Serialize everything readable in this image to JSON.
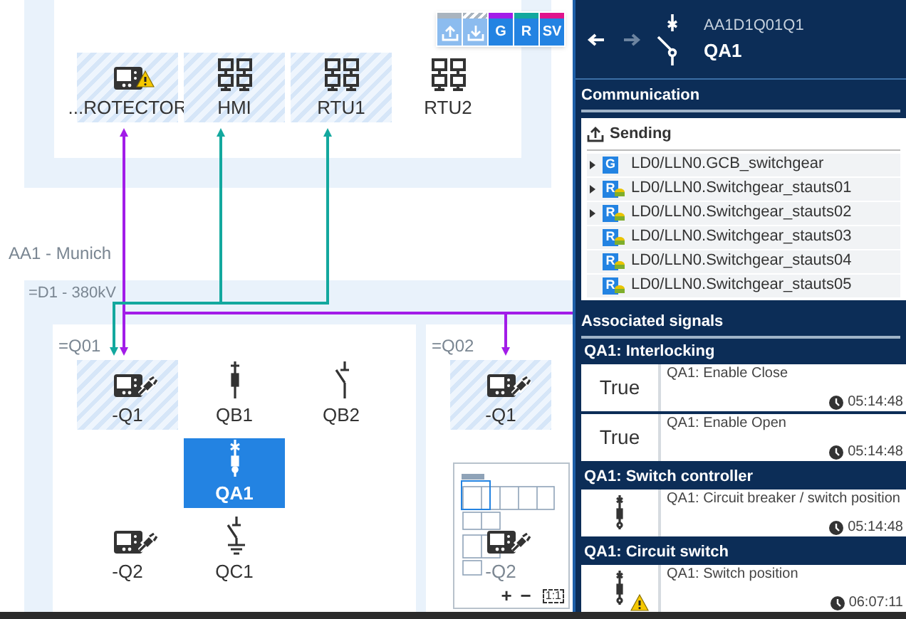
{
  "canvas": {
    "toolbar": [
      {
        "kind": "send",
        "color": "#a9b4bf"
      },
      {
        "kind": "receive",
        "color": "#a9b4bf"
      },
      {
        "kind": "letter",
        "label": "G",
        "color": "#a21ce8"
      },
      {
        "kind": "letter",
        "label": "R",
        "color": "#13a89e"
      },
      {
        "kind": "letter",
        "label": "SV",
        "color": "#e0138c"
      }
    ],
    "station": {
      "devices": [
        {
          "label": "...ROTECTOR",
          "kind": "ied",
          "hatched": true,
          "warning": true,
          "selected": false
        },
        {
          "label": "HMI",
          "kind": "network",
          "hatched": true,
          "warning": false,
          "selected": false
        },
        {
          "label": "RTU1",
          "kind": "network",
          "hatched": true,
          "warning": false,
          "selected": false
        },
        {
          "label": "RTU2",
          "kind": "network",
          "hatched": false,
          "warning": false,
          "selected": false
        }
      ]
    },
    "area_label": "AA1 - Munich",
    "voltage_level": {
      "label": "=D1 - 380kV",
      "bays": [
        {
          "label": "=Q01",
          "devices": [
            {
              "label": "-Q1",
              "kind": "ied-plug",
              "hatched": true,
              "warning": false,
              "selected": false
            },
            {
              "label": "QB1",
              "kind": "disconnector",
              "hatched": false,
              "warning": false,
              "selected": false
            },
            {
              "label": "QB2",
              "kind": "disconnector-open",
              "hatched": false,
              "warning": false,
              "selected": false
            },
            {
              "label": "QA1",
              "kind": "breaker",
              "hatched": false,
              "warning": false,
              "selected": true
            },
            {
              "label": "-Q2",
              "kind": "ied-plug",
              "hatched": false,
              "warning": false,
              "selected": false
            },
            {
              "label": "QC1",
              "kind": "earth-switch",
              "hatched": false,
              "warning": false,
              "selected": false
            }
          ]
        },
        {
          "label": "=Q02",
          "devices": [
            {
              "label": "-Q1",
              "kind": "ied-plug",
              "hatched": true,
              "warning": false,
              "selected": false
            },
            {
              "label": "-Q2",
              "kind": "ied-plug",
              "hatched": false,
              "warning": false,
              "selected": false
            }
          ]
        }
      ]
    },
    "connections": [
      {
        "color": "#a21ce8"
      },
      {
        "color": "#13a89e"
      }
    ],
    "minimap": {
      "zoom_controls": [
        "+",
        "−",
        "1:1"
      ]
    }
  },
  "panel": {
    "subtitle": "AA1D1Q01Q1",
    "title": "QA1",
    "communication": {
      "title": "Communication",
      "sending_label": "Sending",
      "items": [
        {
          "badge": "G",
          "kind": "goose",
          "label": "LD0/LLN0.GCB_switchgear",
          "expandable": true
        },
        {
          "badge": "R",
          "kind": "report",
          "label": "LD0/LLN0.Switchgear_stauts01",
          "expandable": true
        },
        {
          "badge": "R",
          "kind": "report",
          "label": "LD0/LLN0.Switchgear_stauts02",
          "expandable": true
        },
        {
          "badge": "R",
          "kind": "report",
          "label": "LD0/LLN0.Switchgear_stauts03",
          "expandable": false
        },
        {
          "badge": "R",
          "kind": "report",
          "label": "LD0/LLN0.Switchgear_stauts04",
          "expandable": false
        },
        {
          "badge": "R",
          "kind": "report",
          "label": "LD0/LLN0.Switchgear_stauts05",
          "expandable": false
        }
      ]
    },
    "signals": {
      "title": "Associated signals",
      "groups": [
        {
          "title": "QA1: Interlocking",
          "signals": [
            {
              "kind": "text",
              "value": "True",
              "name": "QA1: Enable Close",
              "time": "05:14:48",
              "warning": false
            },
            {
              "kind": "text",
              "value": "True",
              "name": "QA1: Enable Open",
              "time": "05:14:48",
              "warning": false
            }
          ]
        },
        {
          "title": "QA1: Switch controller",
          "signals": [
            {
              "kind": "switch",
              "name": "QA1: Circuit breaker / switch position",
              "time": "05:14:48",
              "warning": false
            }
          ]
        },
        {
          "title": "QA1: Circuit switch",
          "signals": [
            {
              "kind": "switch",
              "name": "QA1: Switch position",
              "time": "06:07:11",
              "warning": true
            }
          ]
        }
      ]
    }
  }
}
